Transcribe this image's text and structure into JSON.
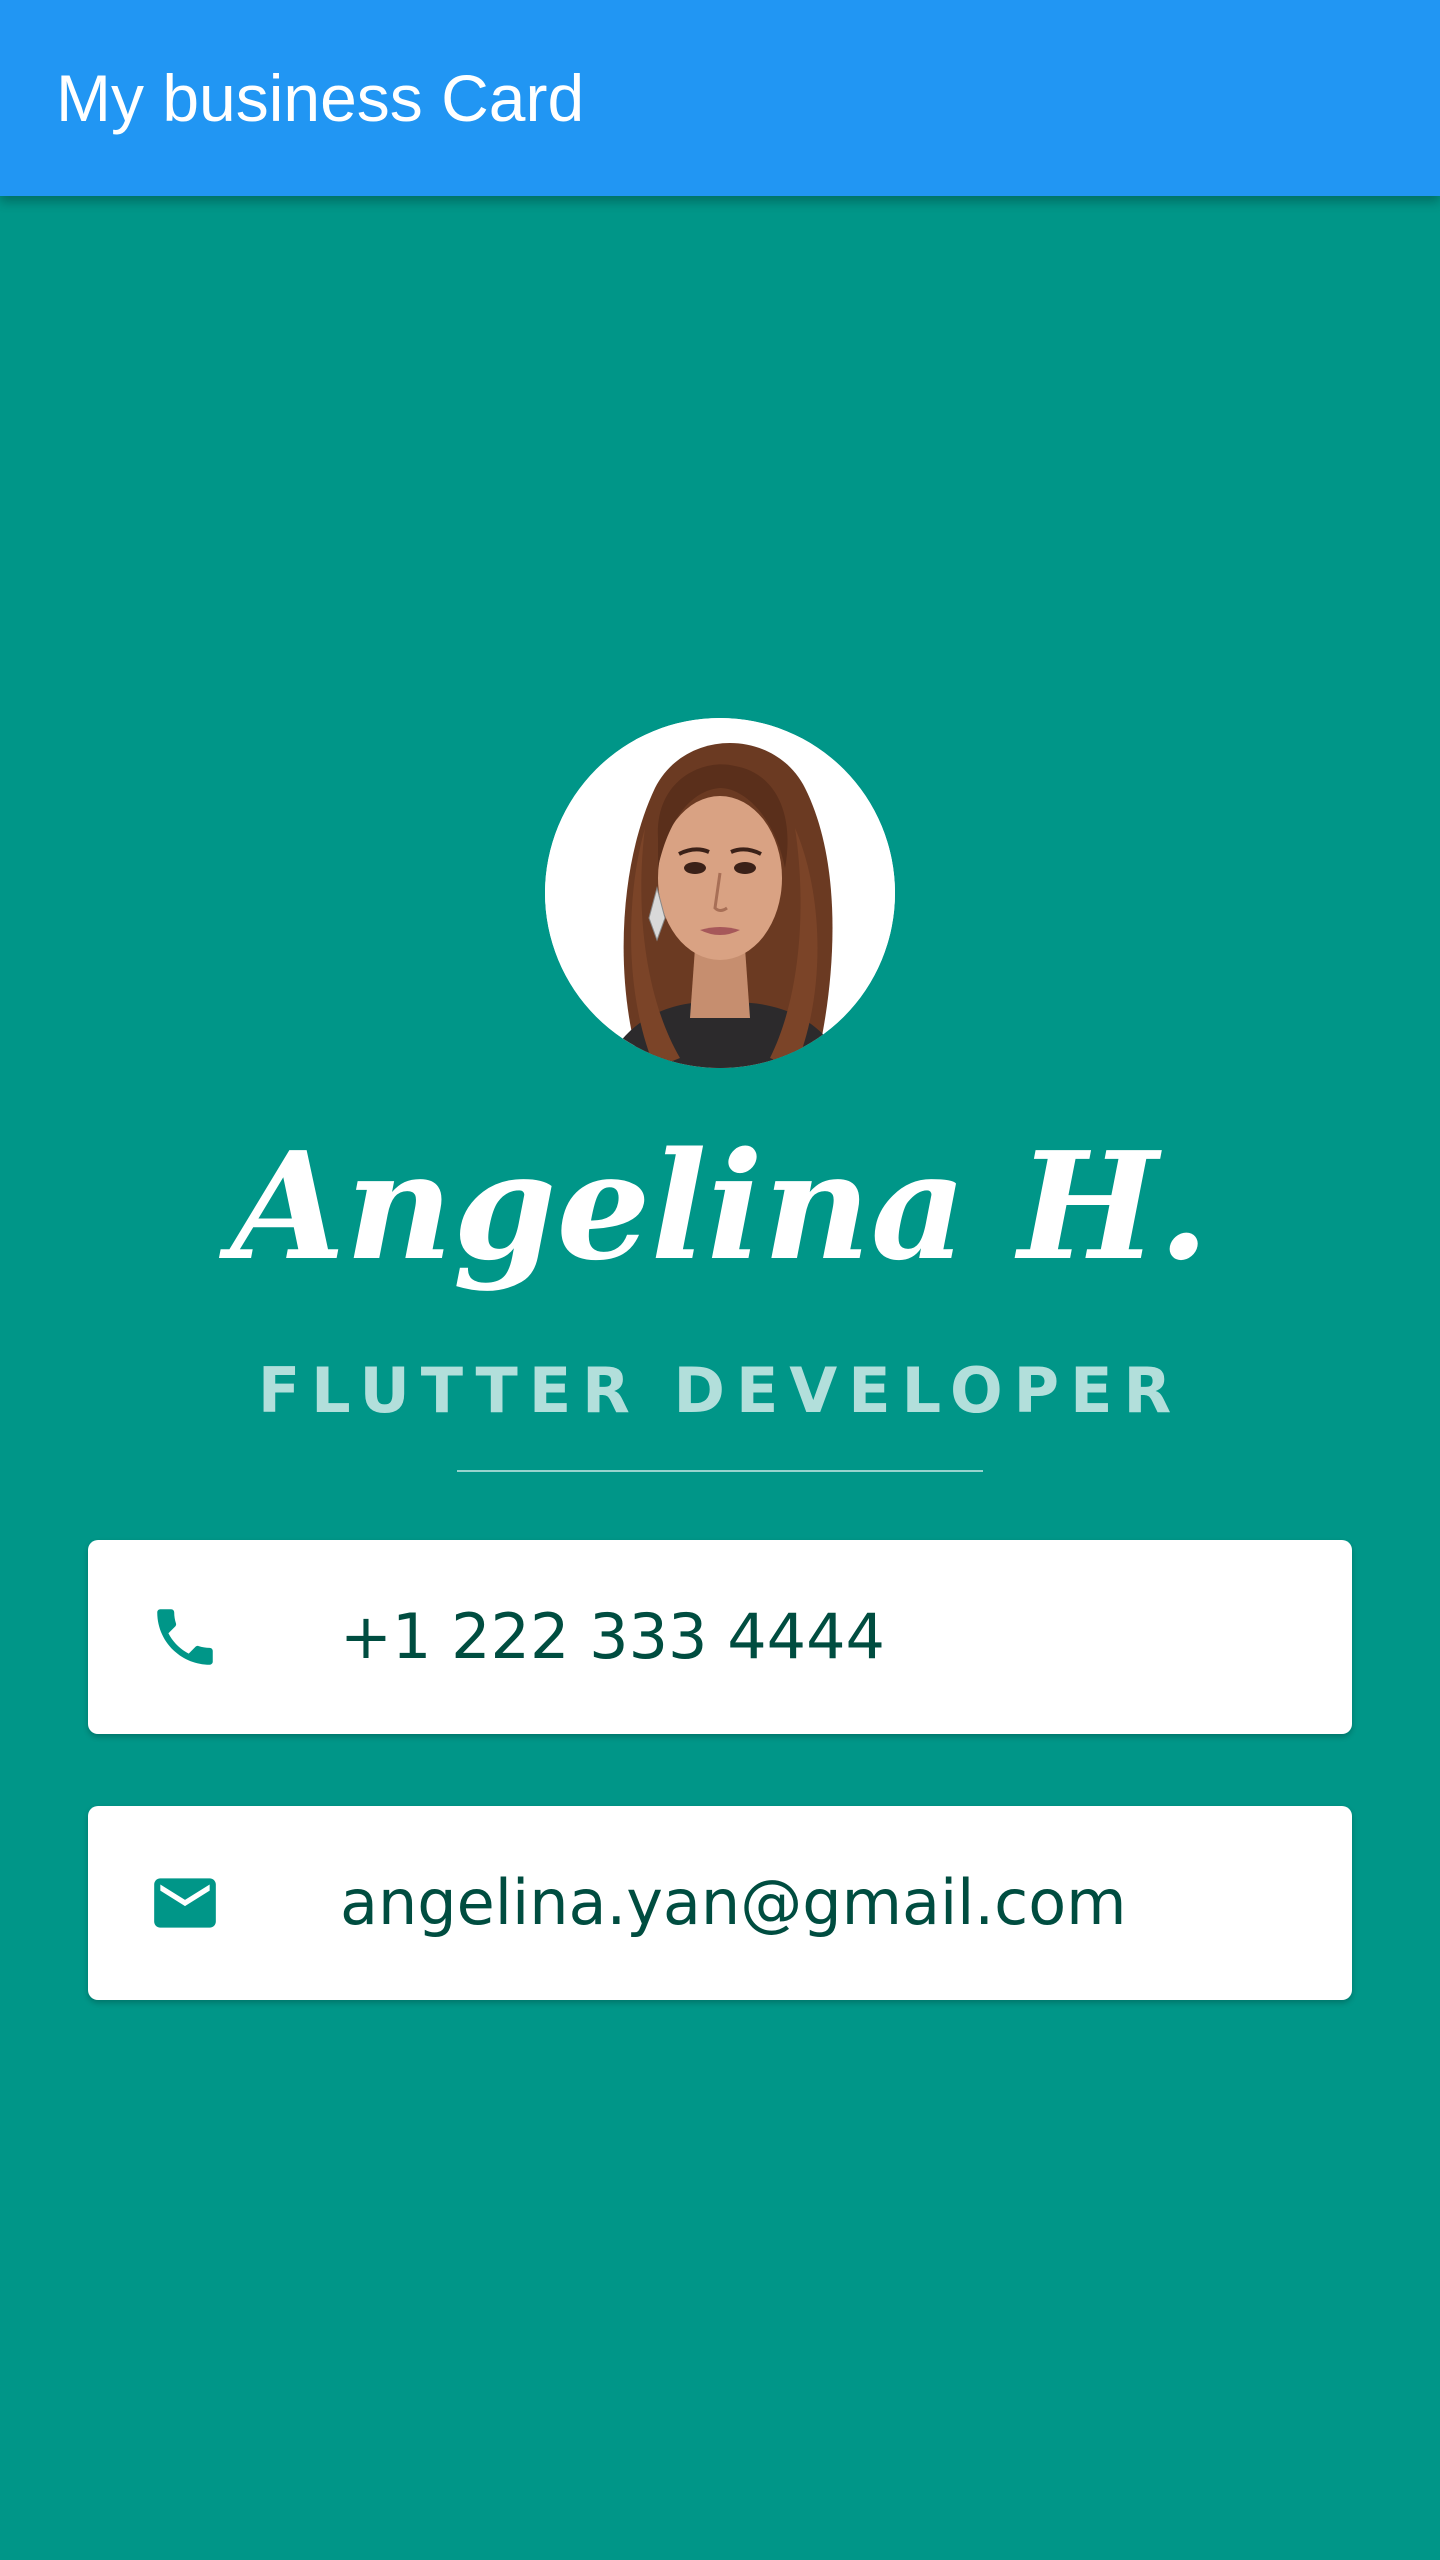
{
  "appbar": {
    "title": "My business Card"
  },
  "profile": {
    "name": "Angelina H.",
    "job_title": "FLUTTER DEVELOPER"
  },
  "contacts": [
    {
      "icon": "phone-icon",
      "value": "+1 222 333 4444"
    },
    {
      "icon": "mail-icon",
      "value": "angelina.yan@gmail.com"
    }
  ],
  "colors": {
    "appbar": "#2196f3",
    "background": "#009688",
    "card": "#ffffff",
    "icon": "#009688",
    "card_text": "#004d40",
    "job_title": "#b2dfdb",
    "name": "#ffffff"
  }
}
